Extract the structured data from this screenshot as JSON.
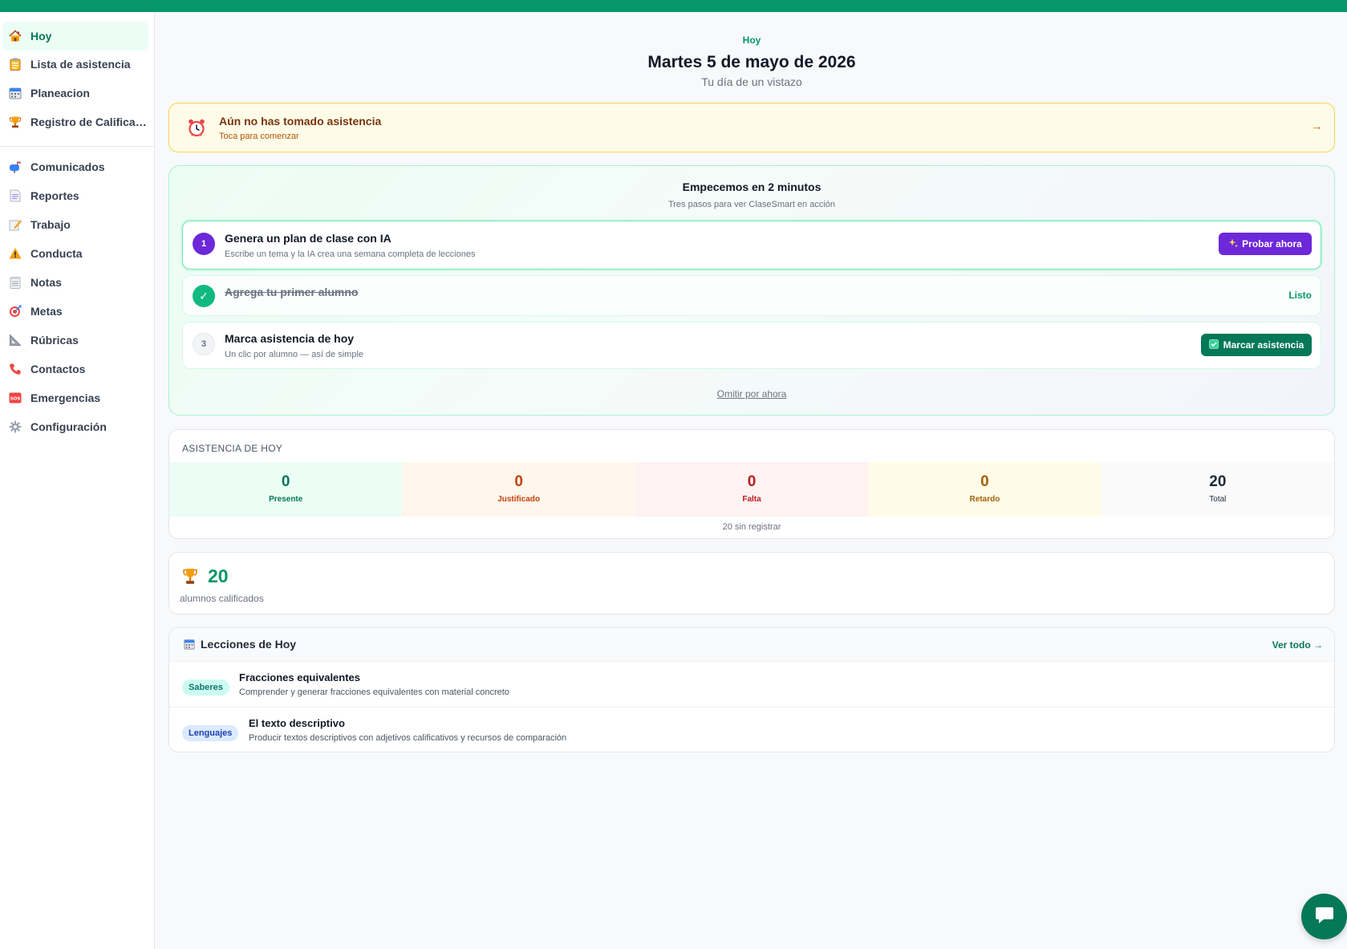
{
  "sidebar": {
    "items": [
      {
        "label": "Hoy",
        "icon": "home-icon"
      },
      {
        "label": "Lista de asistencia",
        "icon": "clipboard-icon"
      },
      {
        "label": "Planeacion",
        "icon": "calendar-icon"
      },
      {
        "label": "Registro de Calificaciones",
        "icon": "trophy-icon"
      },
      {
        "label": "Comunicados",
        "icon": "mailbox-icon"
      },
      {
        "label": "Reportes",
        "icon": "report-icon"
      },
      {
        "label": "Trabajo",
        "icon": "pencil-icon"
      },
      {
        "label": "Conducta",
        "icon": "warning-icon"
      },
      {
        "label": "Notas",
        "icon": "notepad-icon"
      },
      {
        "label": "Metas",
        "icon": "target-icon"
      },
      {
        "label": "Rúbricas",
        "icon": "ruler-icon"
      },
      {
        "label": "Contactos",
        "icon": "phone-icon"
      },
      {
        "label": "Emergencias",
        "icon": "sos-icon"
      },
      {
        "label": "Configuración",
        "icon": "gear-icon"
      }
    ],
    "active_index": 0
  },
  "header": {
    "tag": "Hoy",
    "title": "Martes 5 de mayo de 2026",
    "subtitle": "Tu día de un vistazo"
  },
  "alert": {
    "title": "Aún no has tomado asistencia",
    "subtitle": "Toca para comenzar",
    "arrow": "→",
    "icon": "alarm-clock-icon"
  },
  "onboarding": {
    "title": "Empecemos en 2 minutos",
    "subtitle": "Tres pasos para ver ClaseSmart en acción",
    "steps": [
      {
        "number": "1",
        "title": "Genera un plan de clase con IA",
        "description": "Escribe un tema y la IA crea una semana completa de lecciones",
        "action_label": "Probar ahora",
        "action_icon": "sparkles-icon"
      },
      {
        "number": "✓",
        "title": "Agrega tu primer alumno",
        "status": "Listo"
      },
      {
        "number": "3",
        "title": "Marca asistencia de hoy",
        "description": "Un clic por alumno — así de simple",
        "action_label": "Marcar asistencia",
        "action_icon": "check-box-icon"
      }
    ],
    "skip_label": "Omitir por ahora"
  },
  "attendance": {
    "heading": "ASISTENCIA DE HOY",
    "cells": [
      {
        "value": "0",
        "label": "Presente",
        "bg": "#ecfdf5",
        "color": "#047857"
      },
      {
        "value": "0",
        "label": "Justificado",
        "bg": "#fff7ed",
        "color": "#c2410c"
      },
      {
        "value": "0",
        "label": "Falta",
        "bg": "#fef2f2",
        "color": "#b91c1c"
      },
      {
        "value": "0",
        "label": "Retardo",
        "bg": "#fefce8",
        "color": "#a16207"
      },
      {
        "value": "20",
        "label": "Total",
        "bg": "#fafafa",
        "color": "#1f2937"
      }
    ],
    "footer": "20 sin registrar"
  },
  "graded": {
    "count": "20",
    "label": "alumnos calificados",
    "icon": "trophy-icon"
  },
  "lessons": {
    "title": "Lecciones de Hoy",
    "view_all": "Ver todo →",
    "items": [
      {
        "chip": "Saberes",
        "title": "Fracciones equivalentes",
        "description": "Comprender y generar fracciones equivalentes con material concreto"
      },
      {
        "chip": "Lenguajes",
        "title": "El texto descriptivo",
        "description": "Producir textos descriptivos con adjetivos calificativos y recursos de comparación"
      }
    ]
  },
  "colors": {
    "brand": "#059669",
    "brand_dark": "#047857",
    "accent_purple": "#6d28d9",
    "warning_bg": "#fefce8",
    "warning_border": "#fcd34d"
  }
}
